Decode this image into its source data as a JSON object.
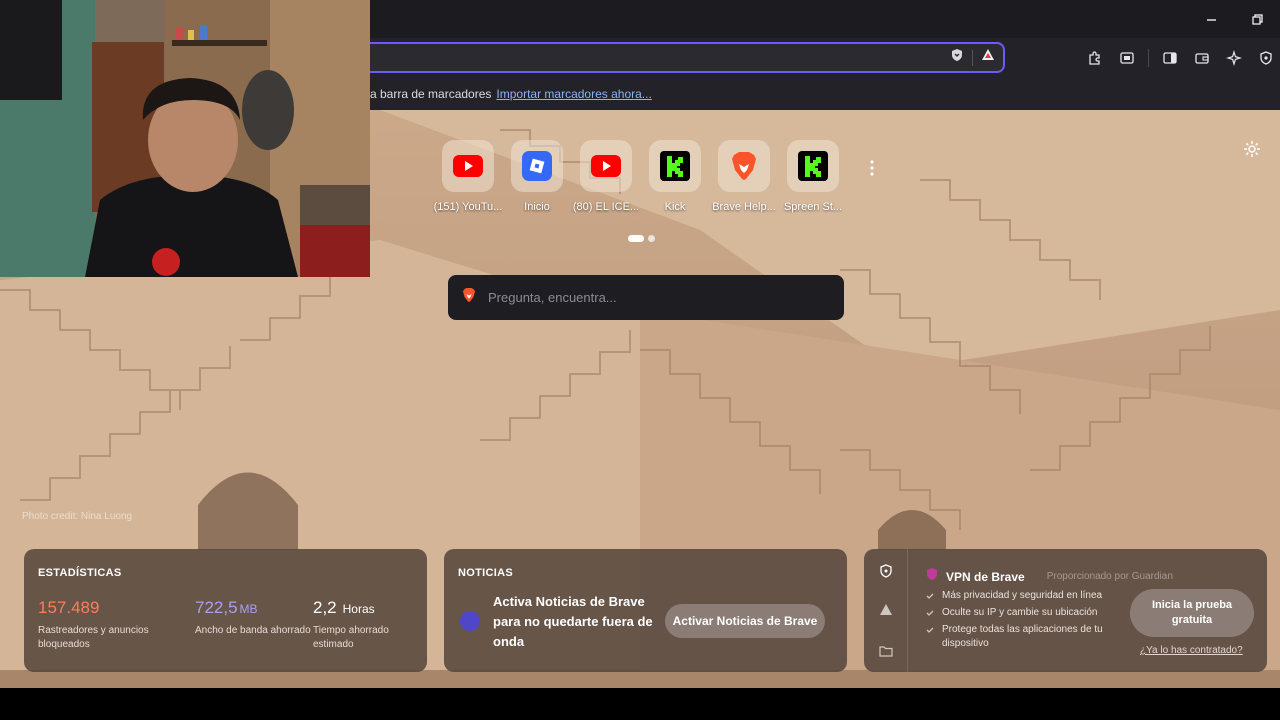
{
  "bookmarks_bar": {
    "prompt": "a barra de marcadores",
    "import_link": "Importar marcadores ahora..."
  },
  "top_sites": [
    {
      "label": "(151) YouTu...",
      "icon": "youtube-icon"
    },
    {
      "label": "Inicio",
      "icon": "roblox-icon"
    },
    {
      "label": "(80) EL ICE...",
      "icon": "youtube-icon"
    },
    {
      "label": "Kick",
      "icon": "kick-icon"
    },
    {
      "label": "Brave Help...",
      "icon": "brave-lion-icon"
    },
    {
      "label": "Spreen St...",
      "icon": "kick-icon"
    }
  ],
  "search": {
    "placeholder": "Pregunta, encuentra..."
  },
  "photo_credit": "Photo credit: Nina Luong",
  "stats": {
    "title": "ESTADÍSTICAS",
    "trackers": {
      "value": "157.489",
      "label": "Rastreadores y anuncios bloqueados",
      "color": "#fd7d5b"
    },
    "bandwidth": {
      "value": "722,5",
      "unit": "MB",
      "label": "Ancho de banda ahorrado",
      "color": "#a79ff5"
    },
    "time": {
      "value": "2,2",
      "unit": "Horas",
      "label": "Tiempo ahorrado estimado",
      "color": "#ffffff"
    }
  },
  "news": {
    "title": "NOTICIAS",
    "text": "Activa Noticias de Brave para no quedarte fuera de onda",
    "button": "Activar Noticias de Brave"
  },
  "vpn": {
    "title": "VPN de Brave",
    "provided_by": "Proporcionado por  Guardian",
    "features": [
      "Más privacidad y seguridad en línea",
      "Oculte su IP y cambie su ubicación",
      "Protege todas las aplicaciones de tu dispositivo"
    ],
    "button": "Inicia la prueba gratuita",
    "trust_link": "¿Ya lo has contratado?"
  }
}
